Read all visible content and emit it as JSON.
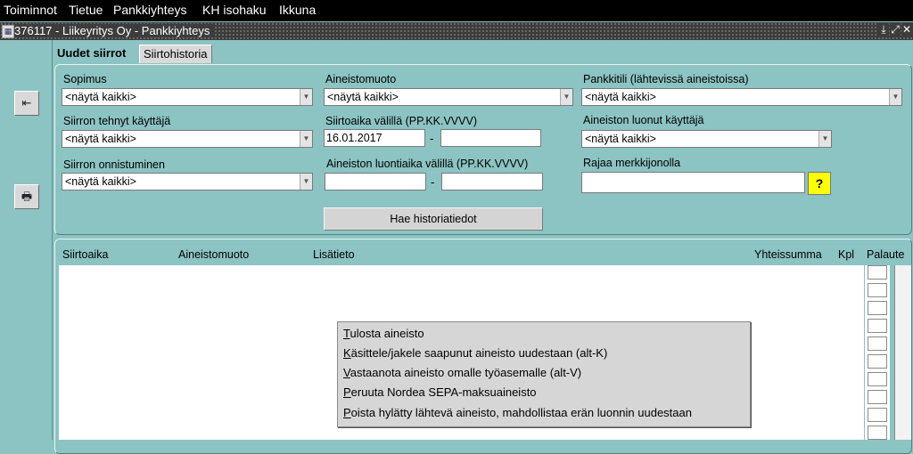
{
  "menu": {
    "items": [
      {
        "label": "Toiminnot"
      },
      {
        "label": "Tietue"
      },
      {
        "label": "Pankkiyhteys"
      },
      {
        "label": "KH isohaku"
      },
      {
        "label": "Ikkuna"
      }
    ]
  },
  "window": {
    "title": "376117 - Liikeyritys Oy - Pankkiyhteys"
  },
  "tabs": [
    {
      "label": "Uudet siirrot"
    },
    {
      "label": "Siirtohistoria"
    }
  ],
  "filters": {
    "sopimus": {
      "label": "Sopimus",
      "value": "<näytä kaikki>"
    },
    "aineistomuoto": {
      "label": "Aineistomuoto",
      "value": "<näytä kaikki>"
    },
    "pankkitili": {
      "label": "Pankkitili (lähtevissä aineistoissa)",
      "value": "<näytä kaikki>"
    },
    "siirron_tehnyt": {
      "label": "Siirron tehnyt käyttäjä",
      "value": "<näytä kaikki>"
    },
    "siirtoaika": {
      "label": "Siirtoaika välillä (PP.KK.VVVV)",
      "from": "16.01.2017",
      "to": "",
      "separator": "-"
    },
    "aineiston_luonut": {
      "label": "Aineiston luonut käyttäjä",
      "value": "<näytä kaikki>"
    },
    "siirron_onnistuminen": {
      "label": "Siirron onnistuminen",
      "value": "<näytä kaikki>"
    },
    "luontiaika": {
      "label": "Aineiston luontiaika välillä (PP.KK.VVVV)",
      "from": "",
      "to": "",
      "separator": "-"
    },
    "rajaa": {
      "label": "Rajaa merkkijonolla",
      "value": "",
      "help_label": "?"
    }
  },
  "search_button": "Hae historiatiedot",
  "table": {
    "columns": [
      "Siirtoaika",
      "Aineistomuoto",
      "Lisätieto",
      "Yhteissumma",
      "Kpl",
      "Palaute"
    ]
  },
  "context_menu": {
    "items": [
      {
        "mnemonic": "T",
        "rest": "ulosta aineisto"
      },
      {
        "mnemonic": "K",
        "rest": "äsittele/jakele saapunut aineisto uudestaan (alt-K)"
      },
      {
        "mnemonic": "V",
        "rest": "astaanota aineisto omalle työasemalle (alt-V)"
      },
      {
        "mnemonic": "P",
        "rest": "eruuta Nordea SEPA-maksuaineisto"
      },
      {
        "mnemonic": "P",
        "rest": "oista hylätty lähtevä aineisto, mahdollistaa erän luonnin uudestaan"
      }
    ]
  },
  "icons": {
    "side_button_1": "exit-arrow-icon",
    "side_button_2": "printer-icon",
    "app_icon": "window-app-icon"
  }
}
